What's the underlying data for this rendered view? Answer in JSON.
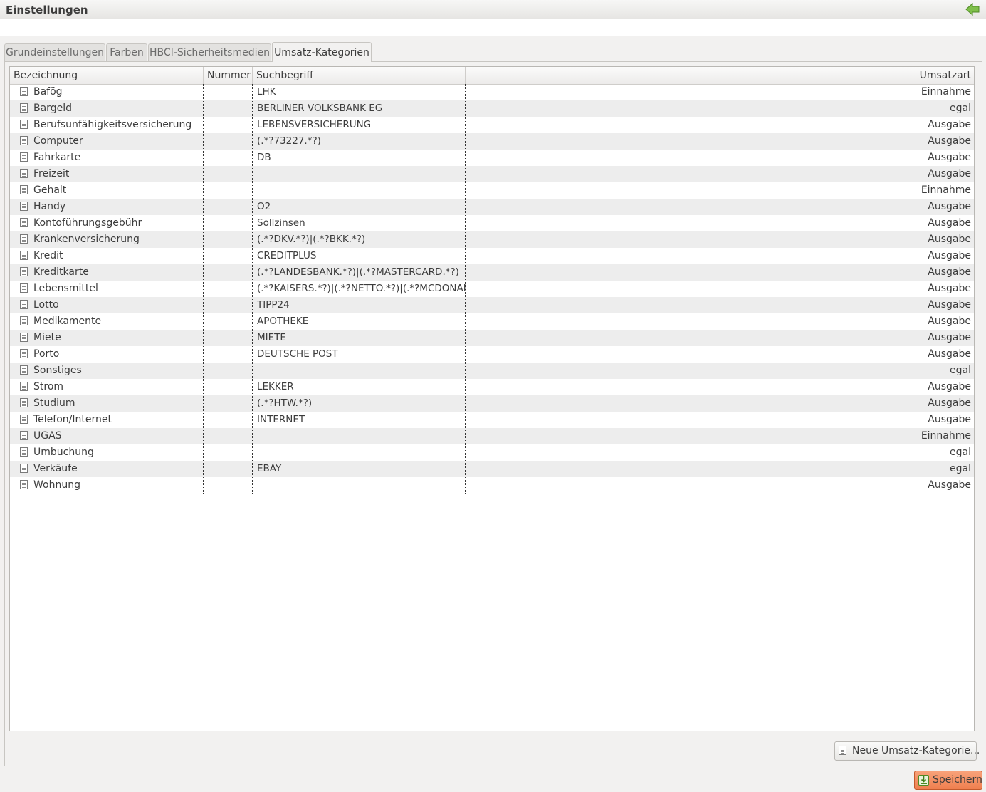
{
  "window": {
    "title": "Einstellungen"
  },
  "tabs": [
    {
      "label": "Grundeinstellungen"
    },
    {
      "label": "Farben"
    },
    {
      "label": "HBCI-Sicherheitsmedien"
    },
    {
      "label": "Umsatz-Kategorien",
      "active": true
    }
  ],
  "table": {
    "headers": {
      "name": "Bezeichnung",
      "nummer": "Nummer",
      "suchbegriff": "Suchbegriff",
      "umsatzart": "Umsatzart"
    },
    "rows": [
      {
        "name": "Bafög",
        "nummer": "",
        "suchbegriff": "LHK",
        "umsatzart": "Einnahme"
      },
      {
        "name": "Bargeld",
        "nummer": "",
        "suchbegriff": "BERLINER VOLKSBANK EG",
        "umsatzart": "egal"
      },
      {
        "name": "Berufsunfähigkeitsversicherung",
        "nummer": "",
        "suchbegriff": "LEBENSVERSICHERUNG",
        "umsatzart": "Ausgabe"
      },
      {
        "name": "Computer",
        "nummer": "",
        "suchbegriff": "(.*?73227.*?)",
        "umsatzart": "Ausgabe"
      },
      {
        "name": "Fahrkarte",
        "nummer": "",
        "suchbegriff": "DB",
        "umsatzart": "Ausgabe"
      },
      {
        "name": "Freizeit",
        "nummer": "",
        "suchbegriff": "",
        "umsatzart": "Ausgabe"
      },
      {
        "name": "Gehalt",
        "nummer": "",
        "suchbegriff": "",
        "umsatzart": "Einnahme"
      },
      {
        "name": "Handy",
        "nummer": "",
        "suchbegriff": "O2",
        "umsatzart": "Ausgabe"
      },
      {
        "name": "Kontoführungsgebühr",
        "nummer": "",
        "suchbegriff": "Sollzinsen",
        "umsatzart": "Ausgabe"
      },
      {
        "name": "Krankenversicherung",
        "nummer": "",
        "suchbegriff": "(.*?DKV.*?)|(.*?BKK.*?)",
        "umsatzart": "Ausgabe"
      },
      {
        "name": "Kredit",
        "nummer": "",
        "suchbegriff": "CREDITPLUS",
        "umsatzart": "Ausgabe"
      },
      {
        "name": "Kreditkarte",
        "nummer": "",
        "suchbegriff": "(.*?LANDESBANK.*?)|(.*?MASTERCARD.*?)",
        "umsatzart": "Ausgabe"
      },
      {
        "name": "Lebensmittel",
        "nummer": "",
        "suchbegriff": "(.*?KAISERS.*?)|(.*?NETTO.*?)|(.*?MCDONAL",
        "umsatzart": "Ausgabe"
      },
      {
        "name": "Lotto",
        "nummer": "",
        "suchbegriff": "TIPP24",
        "umsatzart": "Ausgabe"
      },
      {
        "name": "Medikamente",
        "nummer": "",
        "suchbegriff": "APOTHEKE",
        "umsatzart": "Ausgabe"
      },
      {
        "name": "Miete",
        "nummer": "",
        "suchbegriff": "MIETE",
        "umsatzart": "Ausgabe"
      },
      {
        "name": "Porto",
        "nummer": "",
        "suchbegriff": "DEUTSCHE POST",
        "umsatzart": "Ausgabe"
      },
      {
        "name": "Sonstiges",
        "nummer": "",
        "suchbegriff": "",
        "umsatzart": "egal"
      },
      {
        "name": "Strom",
        "nummer": "",
        "suchbegriff": "LEKKER",
        "umsatzart": "Ausgabe"
      },
      {
        "name": "Studium",
        "nummer": "",
        "suchbegriff": "(.*?HTW.*?)",
        "umsatzart": "Ausgabe"
      },
      {
        "name": "Telefon/Internet",
        "nummer": "",
        "suchbegriff": "INTERNET",
        "umsatzart": "Ausgabe"
      },
      {
        "name": "UGAS",
        "nummer": "",
        "suchbegriff": "",
        "umsatzart": "Einnahme"
      },
      {
        "name": "Umbuchung",
        "nummer": "",
        "suchbegriff": "",
        "umsatzart": "egal"
      },
      {
        "name": "Verkäufe",
        "nummer": "",
        "suchbegriff": "EBAY",
        "umsatzart": "egal"
      },
      {
        "name": "Wohnung",
        "nummer": "",
        "suchbegriff": "",
        "umsatzart": "Ausgabe"
      }
    ]
  },
  "buttons": {
    "new_category": "Neue Umsatz-Kategorie...",
    "save": "Speichern"
  },
  "icons": {
    "back": "back-arrow-icon",
    "row": "document-icon",
    "save": "save-icon"
  },
  "colors": {
    "save_button": "#ef7f4f",
    "back_arrow": "#6fae3a"
  }
}
